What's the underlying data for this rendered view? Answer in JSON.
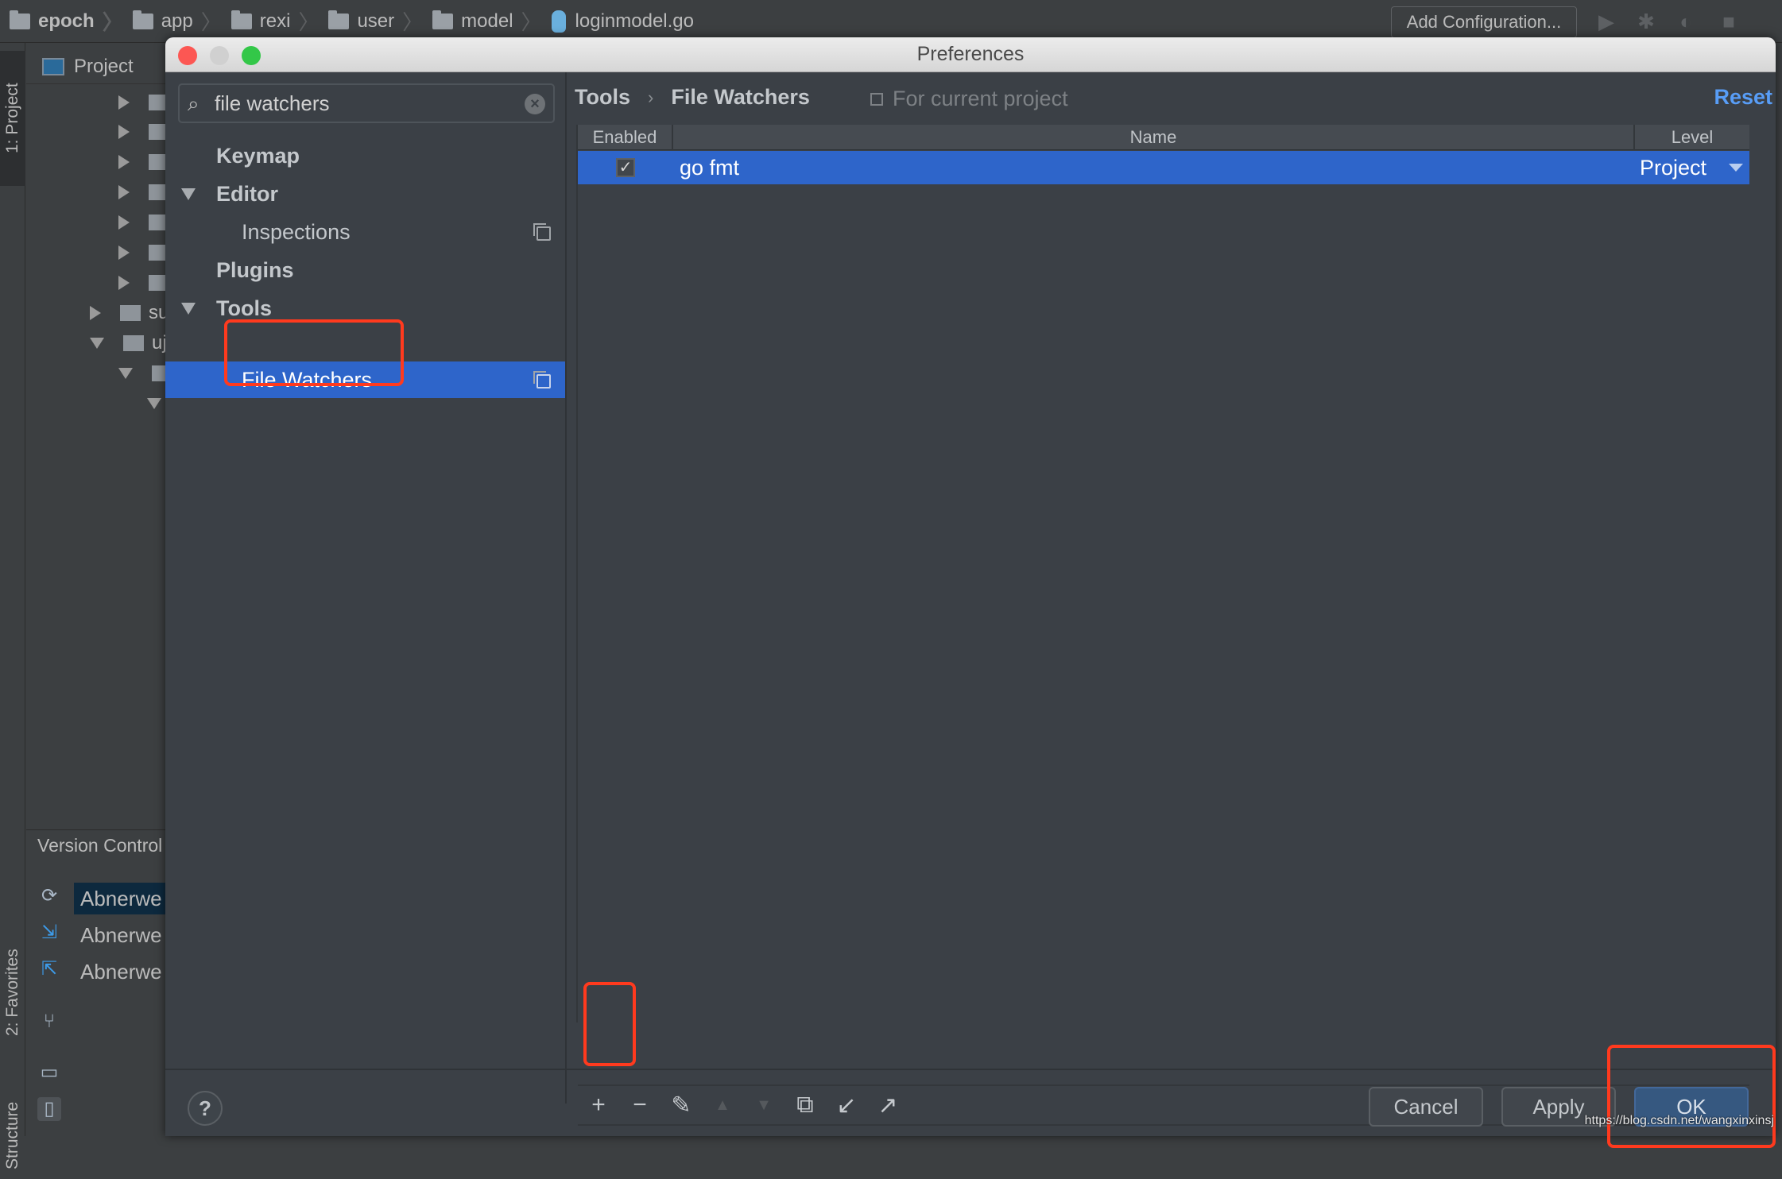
{
  "ide": {
    "breadcrumbs": [
      {
        "label": "epoch",
        "type": "folder"
      },
      {
        "label": "app",
        "type": "folder"
      },
      {
        "label": "rexi",
        "type": "folder"
      },
      {
        "label": "user",
        "type": "folder"
      },
      {
        "label": "model",
        "type": "folder"
      },
      {
        "label": "loginmodel.go",
        "type": "go-file"
      }
    ],
    "add_configuration": "Add Configuration...",
    "toolbar_icons": [
      "run-icon",
      "debug-icon",
      "coverage-icon",
      "stop-icon"
    ],
    "tool_windows": {
      "project": "1: Project",
      "favorites": "2: Favorites",
      "structure": "Structure"
    },
    "project_panel": {
      "title": "Project",
      "partial_items": [
        "su",
        "uj"
      ]
    },
    "version_control": {
      "title": "Version Control",
      "rows": [
        "Abnerwe",
        "Abnerwe",
        "Abnerwe"
      ]
    }
  },
  "dialog": {
    "title": "Preferences",
    "search": {
      "value": "file watchers",
      "placeholder": ""
    },
    "sidebar": {
      "items": [
        {
          "label": "Keymap",
          "level": 0,
          "bold": true
        },
        {
          "label": "Editor",
          "level": 0,
          "bold": true,
          "expanded": true
        },
        {
          "label": "Inspections",
          "level": 1,
          "bold": false,
          "project_scoped": true
        },
        {
          "label": "Plugins",
          "level": 0,
          "bold": true
        },
        {
          "label": "Tools",
          "level": 0,
          "bold": true,
          "expanded": true
        },
        {
          "label": "File Watchers",
          "level": 1,
          "bold": false,
          "selected": true,
          "project_scoped": true
        }
      ]
    },
    "content": {
      "breadcrumb": [
        "Tools",
        "File Watchers"
      ],
      "breadcrumb_sep": "›",
      "scope_label": "For current project",
      "reset_label": "Reset",
      "table": {
        "columns": [
          "Enabled",
          "Name",
          "Level"
        ],
        "rows": [
          {
            "enabled": true,
            "name": "go fmt",
            "level": "Project",
            "selected": true
          }
        ]
      },
      "toolbar": [
        {
          "name": "add-icon",
          "glyph": "+",
          "enabled": true
        },
        {
          "name": "remove-icon",
          "glyph": "−",
          "enabled": true
        },
        {
          "name": "edit-icon",
          "glyph": "✎",
          "enabled": true
        },
        {
          "name": "move-up-icon",
          "glyph": "▲",
          "enabled": false
        },
        {
          "name": "move-down-icon",
          "glyph": "▼",
          "enabled": false
        },
        {
          "name": "copy-icon",
          "glyph": "⧉",
          "enabled": true
        },
        {
          "name": "import-icon",
          "glyph": "↙",
          "enabled": true
        },
        {
          "name": "export-icon",
          "glyph": "↗",
          "enabled": true
        }
      ]
    },
    "footer": {
      "help": "?",
      "cancel": "Cancel",
      "apply": "Apply",
      "ok": "OK"
    }
  },
  "watermark": "https://blog.csdn.net/wangxinxinsj",
  "colors": {
    "selection": "#2e65ca",
    "link": "#589df6",
    "annotation": "#ff3a1e",
    "ok_button": "#365880"
  }
}
